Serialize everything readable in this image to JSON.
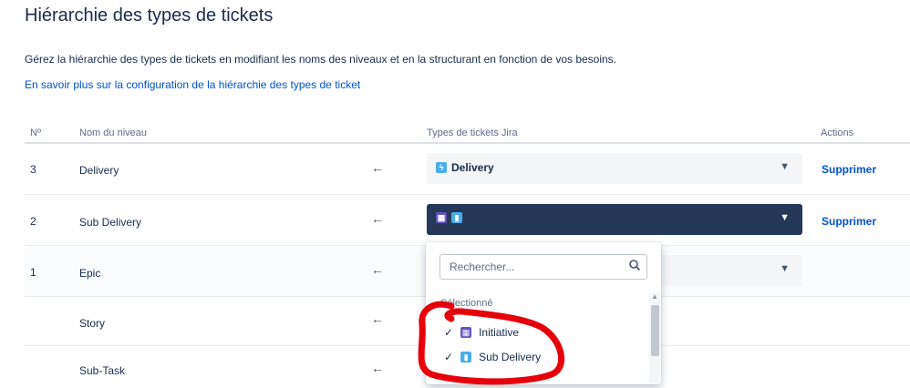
{
  "page": {
    "title": "Hiérarchie des types de tickets",
    "description": "Gérez la hiérarchie des types de tickets en modifiant les noms des niveaux et en la structurant en fonction de vos besoins.",
    "link": "En savoir plus sur la configuration de la hiérarchie des types de ticket"
  },
  "table": {
    "headers": {
      "no": "Nº",
      "name": "Nom du niveau",
      "types": "Types de tickets Jira",
      "actions": "Actions"
    },
    "rows": [
      {
        "no": "3",
        "name": "Delivery",
        "type_label": "Delivery",
        "action": "Supprimer"
      },
      {
        "no": "2",
        "name": "Sub Delivery",
        "type_label": "",
        "action": "Supprimer"
      },
      {
        "no": "1",
        "name": "Epic",
        "type_label": "",
        "action": ""
      },
      {
        "no": "",
        "name": "Story"
      },
      {
        "no": "",
        "name": "Sub-Task"
      }
    ]
  },
  "dropdown": {
    "search_placeholder": "Rechercher...",
    "group_label": "Sélectionné",
    "options": [
      {
        "label": "Initiative",
        "selected": true,
        "icon": "initiative-icon"
      },
      {
        "label": "Sub Delivery",
        "selected": true,
        "icon": "bookmark-icon"
      }
    ]
  },
  "colors": {
    "link": "#0052CC",
    "active_select": "#253858",
    "annotation": "#E5000B"
  }
}
